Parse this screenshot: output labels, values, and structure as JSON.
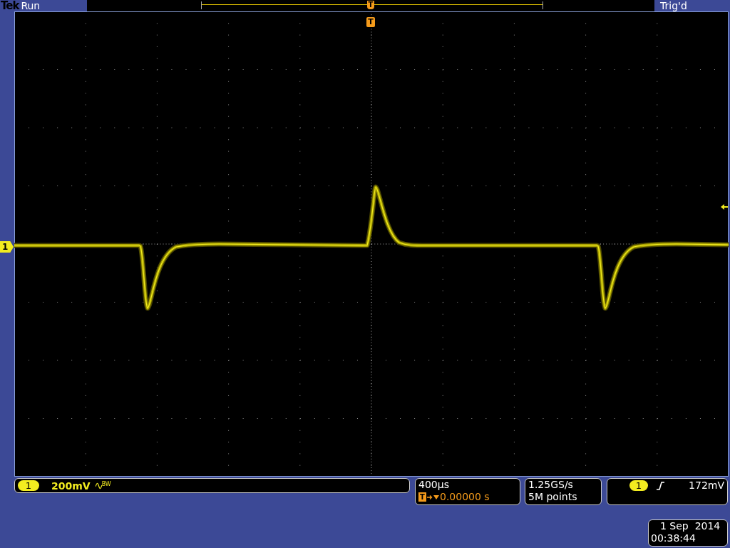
{
  "top_bar": {
    "brand": "Tek",
    "acquisition_state": "Run",
    "trigger_state": "Trig'd"
  },
  "display": {
    "trigger_position_marker": "T",
    "overview_marker": "T",
    "channel_marker": "1",
    "trigger_level_marker": true
  },
  "channel": {
    "number": "1",
    "scale": "200mV",
    "bandwidth_limited": true,
    "bandwidth_label": "BW"
  },
  "horizontal": {
    "scale": "400µs",
    "position_marker": "T",
    "position_value": "0.00000 s"
  },
  "acquisition": {
    "sample_rate": "1.25GS/s",
    "record_length": "5M points"
  },
  "trigger": {
    "source": "1",
    "slope_rising": true,
    "level": "172mV"
  },
  "date_time": {
    "date": "1 Sep  2014",
    "time": "00:38:44"
  }
}
